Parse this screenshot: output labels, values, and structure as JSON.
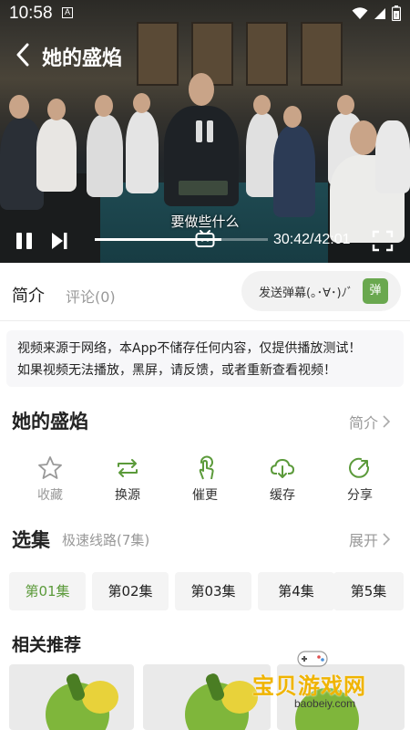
{
  "status_bar": {
    "time": "10:58",
    "notification_letter": "A"
  },
  "player": {
    "title": "她的盛焰",
    "subtitle": "要做些什么",
    "time_display": "30:42/42:01",
    "progress_fraction": 0.73
  },
  "tabs": {
    "intro": "简介",
    "comments": "评论(0)"
  },
  "danmaku": {
    "placeholder": "发送弹幕(｡･∀･)ﾉﾞ",
    "send_label": "弹"
  },
  "notice": {
    "line1": "视频来源于网络，本App不储存任何内容，仅提供播放测试！",
    "line2": "如果视频无法播放，黑屏，请反馈，或者重新查看视频！"
  },
  "show": {
    "title": "她的盛焰",
    "intro_link": "简介"
  },
  "actions": [
    {
      "label": "收藏",
      "icon": "star-icon"
    },
    {
      "label": "换源",
      "icon": "swap-icon"
    },
    {
      "label": "催更",
      "icon": "tap-icon"
    },
    {
      "label": "缓存",
      "icon": "cloud-download-icon"
    },
    {
      "label": "分享",
      "icon": "share-icon"
    }
  ],
  "episodes": {
    "title": "选集",
    "line_info": "极速线路(7集)",
    "expand": "展开",
    "items": [
      "第01集",
      "第02集",
      "第03集",
      "第4集",
      "第5集"
    ],
    "active_index": 0
  },
  "related": {
    "title": "相关推荐"
  },
  "watermark": {
    "text": "宝贝游戏网",
    "domain": "baobeiy.com"
  },
  "colors": {
    "accent": "#5b9a3a",
    "accent_light": "#6aa84f",
    "muted": "#999999"
  }
}
